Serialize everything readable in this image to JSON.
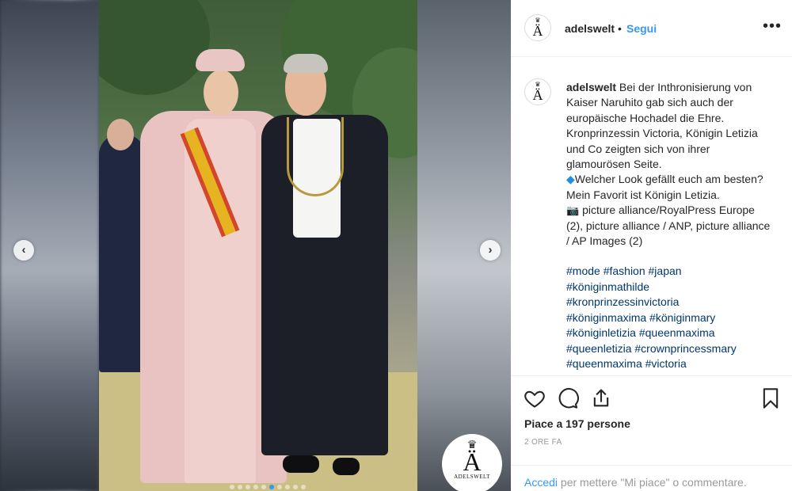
{
  "post": {
    "username": "adelswelt",
    "separator": "•",
    "follow_label": "Segui",
    "more_label": "•••",
    "avatar_letter": "Ä"
  },
  "media": {
    "prev_label": "‹",
    "next_label": "›",
    "slide_count": 10,
    "active_slide": 6,
    "watermark": {
      "crown": "♛",
      "letter": "Ä",
      "text": "ADELSWELT"
    }
  },
  "caption": {
    "username": "adelswelt",
    "text1": "Bei der Inthronisierung von Kaiser Naruhito gab sich auch der europäische Hochadel die Ehre. Kronprinzessin Victoria, Königin Letizia und Co zeigten sich von ihrer glamourösen Seite.",
    "diamond": "◆",
    "text2": "Welcher Look gefällt euch am besten? Mein Favorit ist Königin Letizia.",
    "camera": "📷",
    "text3": "picture alliance/RoyalPress Europe (2), picture alliance / ANP, picture alliance / AP Images (2)",
    "hashtags": [
      "#mode #fashion #japan",
      "#königinmathilde",
      "#kronprinzessinvictoria",
      "#königinmaxima #königinmary",
      "#königinletizia #queenmaxima",
      "#queenletizia #crownprincessmary",
      "#queenmaxima #victoria"
    ]
  },
  "actions": {
    "icons": [
      "heart-icon",
      "comment-icon",
      "share-icon",
      "bookmark-icon"
    ],
    "likes_text": "Piace a 197 persone",
    "timestamp": "2 ORE FA",
    "login_link": "Accedi",
    "login_rest": " per mettere \"Mi piace\" o commentare."
  }
}
